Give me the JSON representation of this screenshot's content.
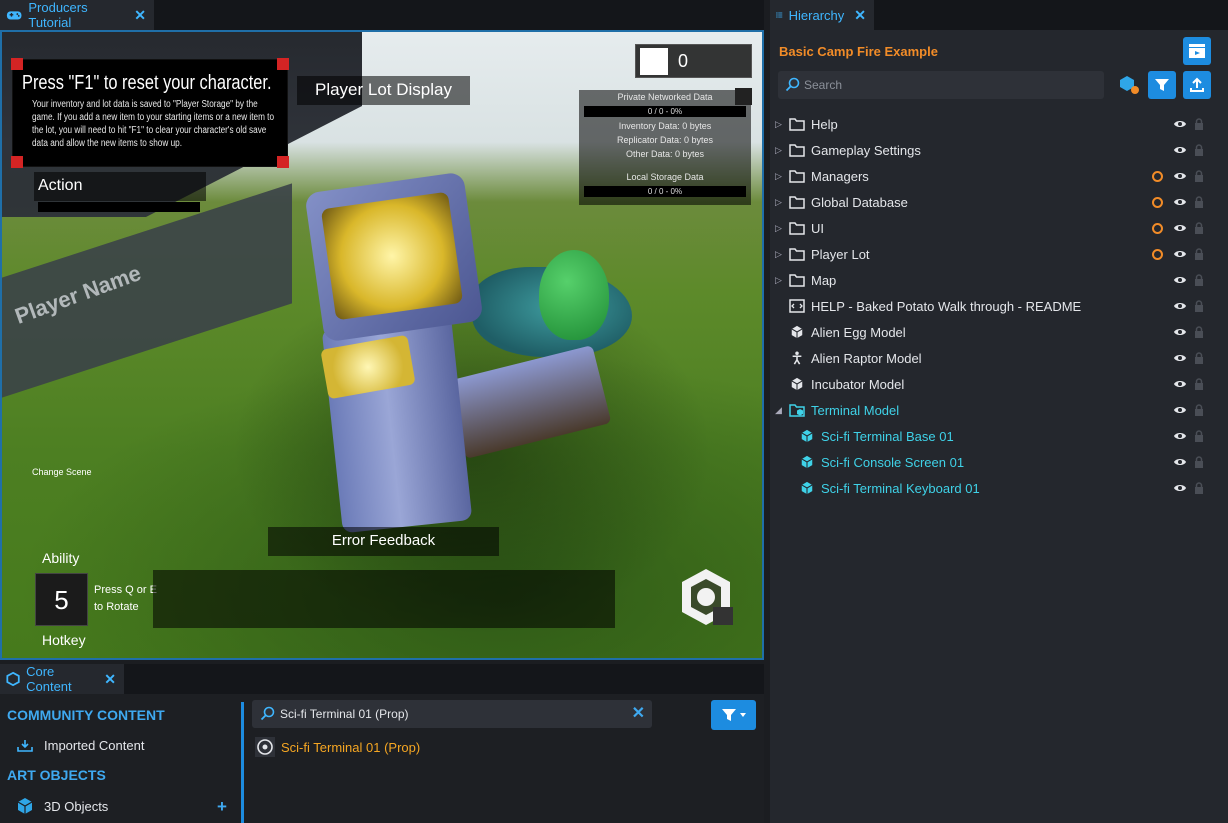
{
  "viewport_tab": {
    "label": "Producers Tutorial"
  },
  "viewport": {
    "reset_title": "Press \"F1\" to reset your character.",
    "reset_text": "Your inventory and lot data is saved to \"Player Storage\" by the game. If you add a new item to your starting items or a new item to the lot, you will need to hit \"F1\" to clear your character's old save data and allow the new items to show up.",
    "player_lot_display": "Player Lot Display",
    "action": "Action",
    "counter_value": "0",
    "stats": {
      "private_title": "Private Networked Data",
      "private_bar": "0 / 0 - 0%",
      "inventory": "Inventory Data: 0 bytes",
      "replicator": "Replicator Data: 0 bytes",
      "other": "Other Data: 0 bytes",
      "local_title": "Local Storage Data",
      "local_bar": "0 / 0 - 0%"
    },
    "error_feedback": "Error Feedback",
    "ability": "Ability",
    "hotkey": "Hotkey",
    "key": "5",
    "press_q": "Press Q or E to Rotate",
    "change_scene": "Change Scene",
    "player_name_decal": "Player Name"
  },
  "core_tab": {
    "label": "Core Content"
  },
  "core": {
    "community_title": "COMMUNITY CONTENT",
    "imported_content": "Imported Content",
    "art_title": "ART OBJECTS",
    "objects_3d": "3D Objects",
    "search_value": "Sci-fi Terminal 01 (Prop)",
    "result": "Sci-fi Terminal 01 (Prop)"
  },
  "hierarchy_tab": {
    "label": "Hierarchy"
  },
  "hierarchy": {
    "title": "Basic Camp Fire Example",
    "search_placeholder": "Search",
    "rows": [
      {
        "label": "Help",
        "icon": "folder-icon",
        "expandable": true,
        "networked": false
      },
      {
        "label": "Gameplay Settings",
        "icon": "folder-icon",
        "expandable": true,
        "networked": false
      },
      {
        "label": "Managers",
        "icon": "folder-icon",
        "expandable": true,
        "networked": true
      },
      {
        "label": "Global Database",
        "icon": "folder-icon",
        "expandable": true,
        "networked": true
      },
      {
        "label": "UI",
        "icon": "folder-icon",
        "expandable": true,
        "networked": true
      },
      {
        "label": "Player Lot",
        "icon": "folder-icon",
        "expandable": true,
        "networked": true
      },
      {
        "label": "Map",
        "icon": "folder-icon",
        "expandable": true,
        "networked": false
      },
      {
        "label": "HELP - Baked Potato Walk through - README",
        "icon": "script-icon",
        "expandable": false,
        "networked": false
      },
      {
        "label": "Alien Egg Model",
        "icon": "cube-icon",
        "expandable": false,
        "networked": false
      },
      {
        "label": "Alien Raptor Model",
        "icon": "figure-icon",
        "expandable": false,
        "networked": false
      },
      {
        "label": "Incubator Model",
        "icon": "cube-icon",
        "expandable": false,
        "networked": false
      },
      {
        "label": "Terminal Model",
        "icon": "group-icon",
        "expandable": true,
        "expanded": true,
        "selected": true,
        "networked": false
      },
      {
        "label": "Sci-fi Terminal Base 01",
        "icon": "cube-icon",
        "child": true,
        "selected": true,
        "networked": false
      },
      {
        "label": "Sci-fi Console Screen 01",
        "icon": "cube-icon",
        "child": true,
        "selected": true,
        "networked": false
      },
      {
        "label": "Sci-fi Terminal Keyboard 01",
        "icon": "cube-icon",
        "child": true,
        "selected": true,
        "networked": false
      }
    ]
  },
  "colors": {
    "accent": "#1d8ce0",
    "tab_text": "#3fb6ff",
    "orange": "#f28c28",
    "selected_text": "#3fd2e8",
    "result_text": "#f5a623"
  }
}
